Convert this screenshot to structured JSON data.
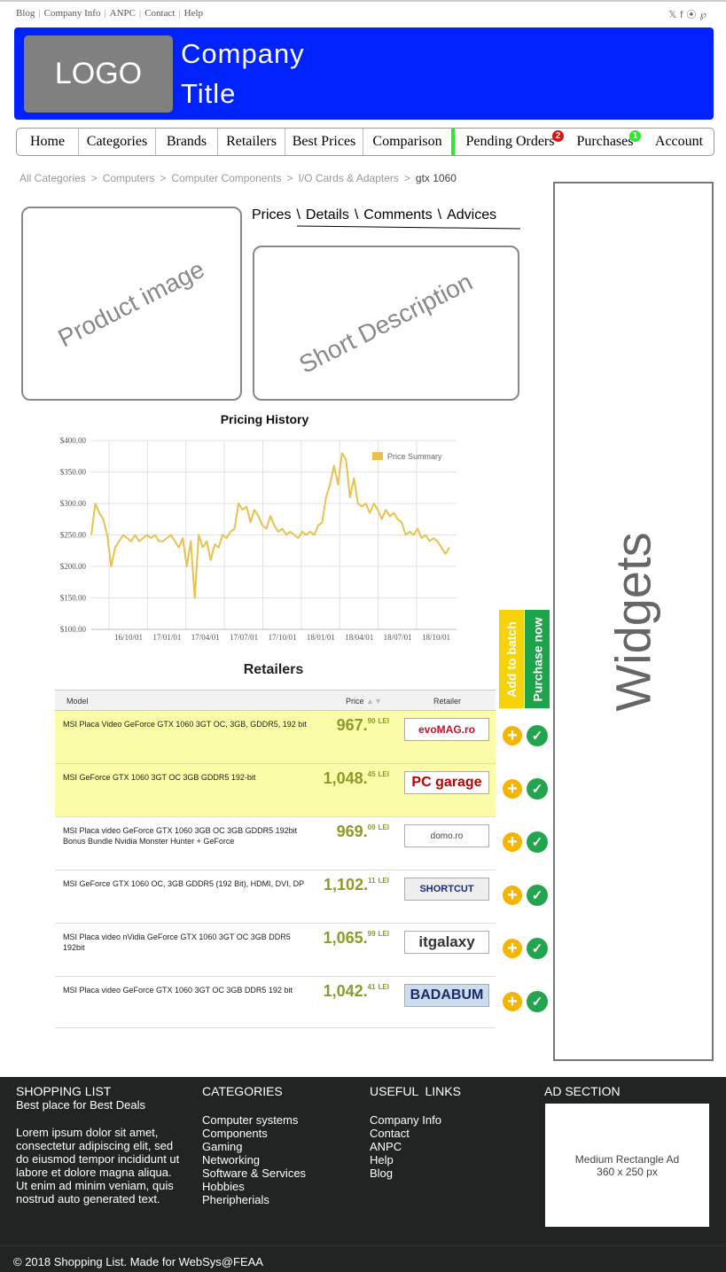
{
  "top_links": [
    "Blog",
    "Company Info",
    "ANPC",
    "Contact",
    "Help"
  ],
  "social_icons": [
    "twitter-icon",
    "facebook-icon",
    "rss-icon",
    "pinterest-icon"
  ],
  "header": {
    "logo": "LOGO",
    "title_line1": "Company",
    "title_line2": "Title"
  },
  "nav": {
    "items": [
      "Home",
      "Categories",
      "Brands",
      "Retailers",
      "Best Prices",
      "Comparison",
      "Pending Orders",
      "Purchases",
      "Account"
    ],
    "pending_badge": "2",
    "purchases_badge": "1"
  },
  "breadcrumb": [
    "All Categories",
    "Computers",
    "Computer Components",
    "I/O Cards & Adapters",
    "gtx 1060"
  ],
  "placeholders": {
    "product_image": "Product image",
    "short_description": "Short Description",
    "widgets": "Widgets"
  },
  "tabs": [
    "Prices",
    "Details",
    "Comments",
    "Advices"
  ],
  "chart_data": {
    "type": "line",
    "title": "Pricing History",
    "legend": "Price Summary",
    "legend_position": "top-right",
    "color": "#e8c14f",
    "ylim": [
      100,
      400
    ],
    "y_ticks": [
      "$400.00",
      "$350.00",
      "$300.00",
      "$250.00",
      "$200.00",
      "$150.00",
      "$100.00"
    ],
    "x_ticks": [
      "16/10/01",
      "17/01/01",
      "17/04/01",
      "17/07/01",
      "17/10/01",
      "18/01/01",
      "18/04/01",
      "18/07/01",
      "18/10/01"
    ],
    "grid": true,
    "values": [
      250,
      300,
      285,
      275,
      250,
      200,
      230,
      240,
      250,
      245,
      240,
      250,
      240,
      245,
      250,
      245,
      250,
      240,
      240,
      245,
      250,
      240,
      230,
      245,
      200,
      240,
      150,
      250,
      230,
      240,
      210,
      235,
      230,
      250,
      245,
      255,
      260,
      300,
      290,
      295,
      270,
      290,
      280,
      265,
      260,
      280,
      265,
      255,
      260,
      250,
      255,
      250,
      245,
      255,
      250,
      255,
      250,
      265,
      270,
      310,
      330,
      360,
      330,
      380,
      370,
      310,
      340,
      300,
      295,
      300,
      285,
      300,
      290,
      275,
      290,
      280,
      285,
      275,
      270,
      250,
      255,
      250,
      260,
      245,
      250,
      240,
      245,
      240,
      230,
      220,
      230
    ]
  },
  "retailers_title": "Retailers",
  "table": {
    "headers": {
      "model": "Model",
      "price": "Price",
      "retailer": "Retailer"
    },
    "rows": [
      {
        "model": "MSI Placa Video GeForce GTX 1060 3GT OC, 3GB, GDDR5, 192 bit",
        "price_int": "967.",
        "price_dec": "90",
        "currency": "LEI",
        "retailer": "evoMAG.ro",
        "highlight": true
      },
      {
        "model": "MSI GeForce GTX 1060 3GT OC 3GB GDDR5 192-bit",
        "price_int": "1,048.",
        "price_dec": "45",
        "currency": "LEI",
        "retailer": "PC garage",
        "highlight": true
      },
      {
        "model": "MSI Placa video GeForce GTX 1060 3GB OC 3GB GDDR5 192bit Bonus Bundle Nvidia Monster Hunter + GeForce",
        "price_int": "969.",
        "price_dec": "00",
        "currency": "LEI",
        "retailer": "domo.ro",
        "highlight": false
      },
      {
        "model": "MSI GeForce GTX 1060 OC, 3GB GDDR5 (192 Bit), HDMI, DVI, DP",
        "price_int": "1,102.",
        "price_dec": "11",
        "currency": "LEI",
        "retailer": "SHORTCUT",
        "highlight": false
      },
      {
        "model": "MSI Placa video nVidia GeForce GTX 1060 3GT OC 3GB DDR5 192bit",
        "price_int": "1,065.",
        "price_dec": "99",
        "currency": "LEI",
        "retailer": "itgalaxy",
        "highlight": false
      },
      {
        "model": "MSI Placa video GeForce GTX 1060 3GT OC 3GB DDR5 192 bit",
        "price_int": "1,042.",
        "price_dec": "41",
        "currency": "LEI",
        "retailer": "BADABUM",
        "highlight": false
      }
    ]
  },
  "side_buttons": {
    "add_to_batch": "Add to batch",
    "purchase_now": "Purchase now"
  },
  "footer": {
    "col1": {
      "title": "SHOPPING LIST",
      "subtitle": "Best place for Best Deals",
      "text": "Lorem ipsum dolor sit amet, consectetur adipiscing elit, sed do eiusmod tempor incididunt ut labore et dolore magna aliqua. Ut enim ad minim veniam, quis nostrud auto generated text."
    },
    "col2": {
      "title": "CATEGORIES",
      "items": [
        "Computer systems",
        "Components",
        "Gaming",
        "Networking",
        "Software & Services",
        "Hobbies",
        "Pheripherials"
      ]
    },
    "col3": {
      "title": "USEFUL  LINKS",
      "items": [
        "Company Info",
        "Contact",
        "ANPC",
        "Help",
        "Blog"
      ]
    },
    "col4": {
      "title": "AD SECTION",
      "ad_line1": "Medium Rectangle Ad",
      "ad_line2": "360 x 250 px"
    },
    "copyright": "© 2018 Shopping List. Made for WebSys@FEAA"
  }
}
